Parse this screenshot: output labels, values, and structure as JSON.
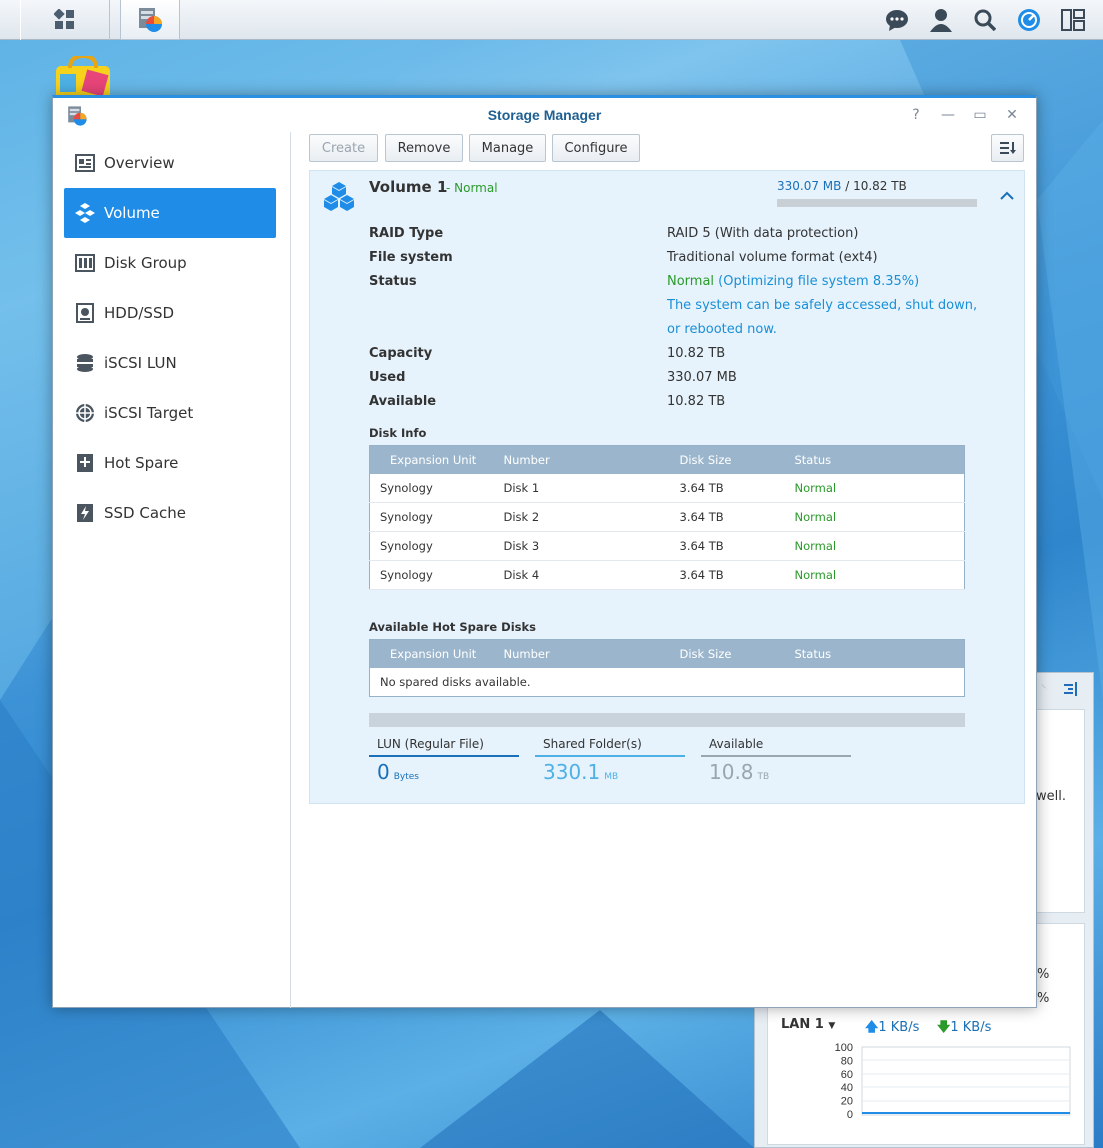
{
  "window": {
    "title": "Storage Manager"
  },
  "sidebar": {
    "items": [
      {
        "label": "Overview",
        "icon": "overview-icon"
      },
      {
        "label": "Volume",
        "icon": "volume-icon"
      },
      {
        "label": "Disk Group",
        "icon": "disk-group-icon"
      },
      {
        "label": "HDD/SSD",
        "icon": "hdd-icon"
      },
      {
        "label": "iSCSI LUN",
        "icon": "iscsi-lun-icon"
      },
      {
        "label": "iSCSI Target",
        "icon": "iscsi-target-icon"
      },
      {
        "label": "Hot Spare",
        "icon": "hot-spare-icon"
      },
      {
        "label": "SSD Cache",
        "icon": "ssd-cache-icon"
      }
    ],
    "active": "Volume"
  },
  "toolbar": {
    "create": "Create",
    "remove": "Remove",
    "manage": "Manage",
    "configure": "Configure"
  },
  "volume": {
    "name": "Volume 1",
    "status_suffix": "- Normal",
    "used": "330.07 MB",
    "separator": " / ",
    "total": "10.82 TB",
    "usage_fraction": 3e-05,
    "props": {
      "raid_type_label": "RAID Type",
      "raid_type": "RAID 5 (With data protection)",
      "fs_label": "File system",
      "fs": "Traditional volume format (ext4)",
      "status_label": "Status",
      "status_normal": "Normal",
      "status_open": " (",
      "status_detail": "Optimizing file system 8.35%)",
      "status_note1": "The system can be safely accessed, shut down,",
      "status_note2": "or rebooted now.",
      "capacity_label": "Capacity",
      "capacity": "10.82 TB",
      "used_label": "Used",
      "used": "330.07 MB",
      "available_label": "Available",
      "available": "10.82 TB"
    },
    "disk_info": {
      "heading": "Disk Info",
      "columns": [
        "Expansion Unit",
        "Number",
        "Disk Size",
        "Status"
      ],
      "rows": [
        [
          "Synology",
          "Disk 1",
          "3.64 TB",
          "Normal"
        ],
        [
          "Synology",
          "Disk 2",
          "3.64 TB",
          "Normal"
        ],
        [
          "Synology",
          "Disk 3",
          "3.64 TB",
          "Normal"
        ],
        [
          "Synology",
          "Disk 4",
          "3.64 TB",
          "Normal"
        ]
      ]
    },
    "hot_spare": {
      "heading": "Available Hot Spare Disks",
      "columns": [
        "Expansion Unit",
        "Number",
        "Disk Size",
        "Status"
      ],
      "empty": "No spared disks available."
    },
    "stats": [
      {
        "label": "LUN (Regular File)",
        "value": "0",
        "unit": "Bytes",
        "color": "#1a70b8"
      },
      {
        "label": "Shared Folder(s)",
        "value": "330.1",
        "unit": "MB",
        "color": "#4fb0e6"
      },
      {
        "label": "Available",
        "value": "10.8",
        "unit": "TB",
        "color": "#9aa5ae"
      }
    ]
  },
  "widget": {
    "peek_text": "well.",
    "peek_pct1": "%",
    "peek_pct2": "%",
    "lan_label": "LAN 1",
    "upload": "1 KB/s",
    "download": "1 KB/s",
    "y_ticks": [
      "100",
      "80",
      "60",
      "40",
      "20",
      "0"
    ]
  },
  "colors": {
    "accent": "#1f8de8",
    "normal_green": "#2a9a2a",
    "link_blue": "#1a8fd6"
  }
}
